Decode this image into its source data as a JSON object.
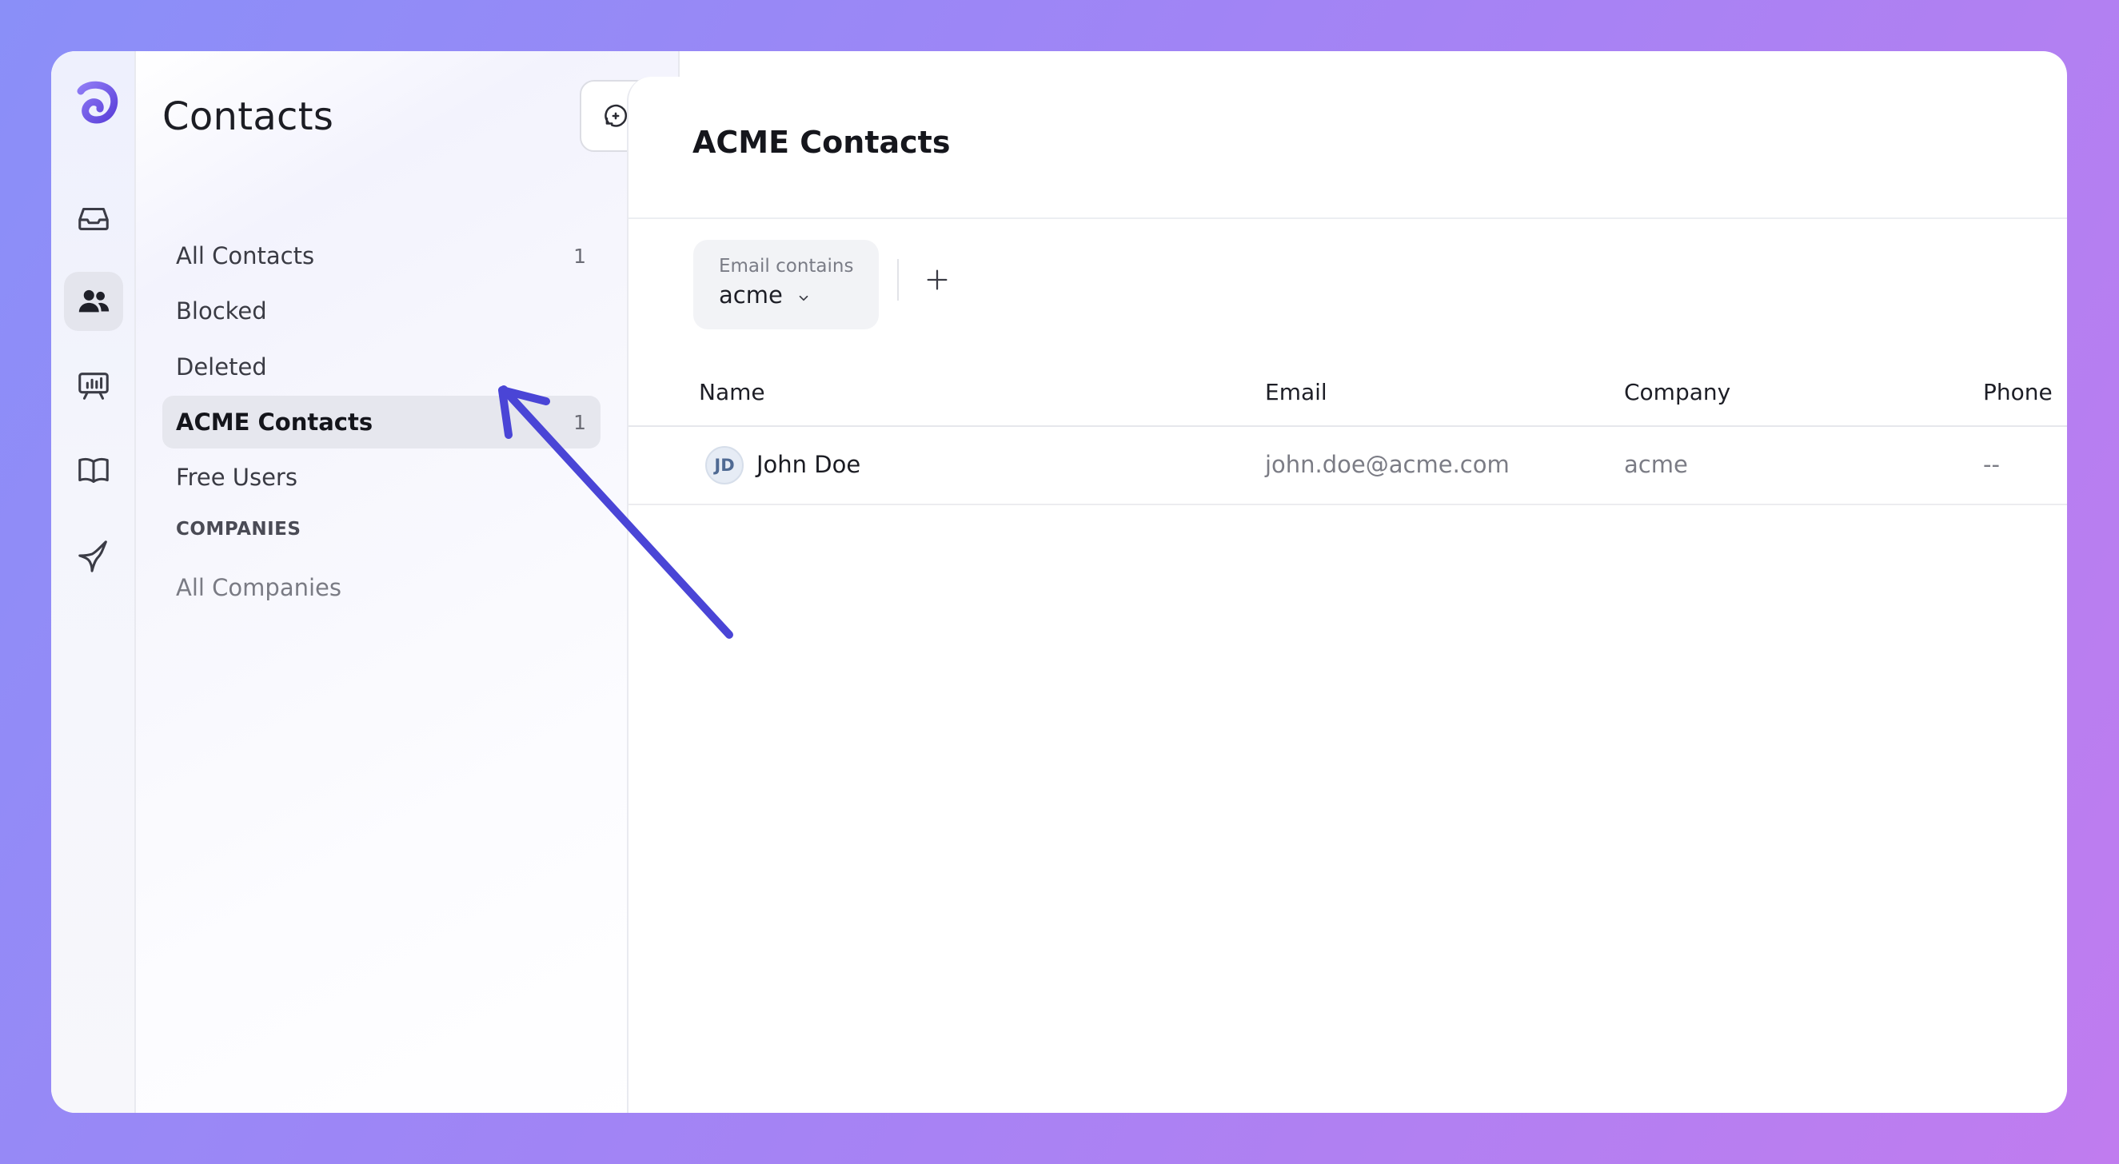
{
  "colors": {
    "accent": "#4a45d6",
    "background_gradient": [
      "#8a8ff8",
      "#c07cef"
    ],
    "active_item": "#e6e7ee"
  },
  "rail": {
    "items": [
      {
        "icon": "app-logo-icon"
      },
      {
        "icon": "inbox-icon"
      },
      {
        "icon": "contacts-icon",
        "active": true
      },
      {
        "icon": "reports-icon"
      },
      {
        "icon": "help-center-icon"
      },
      {
        "icon": "sparkle-icon"
      }
    ]
  },
  "sidebar": {
    "title": "Contacts",
    "new_button_icon": "new-conversation-icon",
    "items": [
      {
        "label": "All Contacts",
        "count": "1"
      },
      {
        "label": "Blocked",
        "count": ""
      },
      {
        "label": "Deleted",
        "count": ""
      },
      {
        "label": "ACME Contacts",
        "count": "1",
        "active": true
      },
      {
        "label": "Free Users",
        "count": ""
      }
    ],
    "section_label": "COMPANIES",
    "companies_item": "All Companies"
  },
  "main": {
    "title": "ACME Contacts",
    "filter": {
      "label": "Email contains",
      "value": "acme"
    },
    "add_filter_icon": "plus-icon",
    "columns": [
      "Name",
      "Email",
      "Company",
      "Phone"
    ],
    "rows": [
      {
        "initials": "JD",
        "name": "John Doe",
        "email": "john.doe@acme.com",
        "company": "acme",
        "phone": "--"
      }
    ]
  }
}
